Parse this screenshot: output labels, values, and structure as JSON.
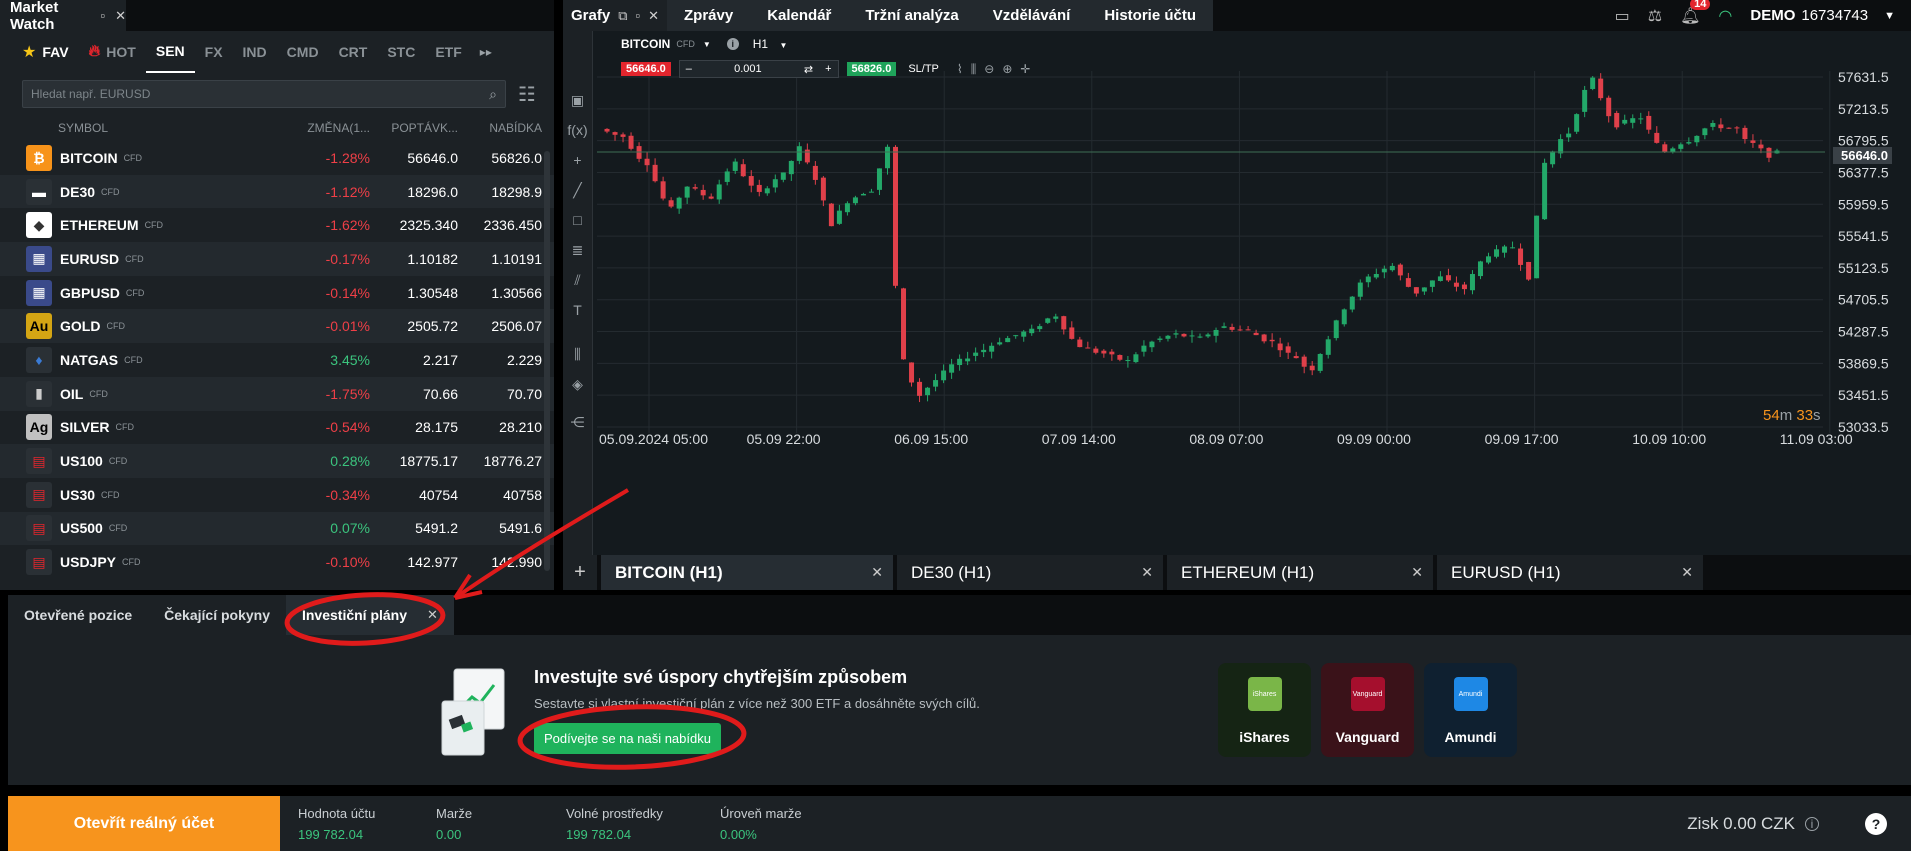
{
  "market_watch": {
    "title": "Market Watch",
    "tabs": [
      {
        "label": "FAV",
        "icon": "star-icon"
      },
      {
        "label": "HOT",
        "icon": "fire-icon"
      },
      {
        "label": "SEN"
      },
      {
        "label": "FX"
      },
      {
        "label": "IND"
      },
      {
        "label": "CMD"
      },
      {
        "label": "CRT"
      },
      {
        "label": "STC"
      },
      {
        "label": "ETF"
      }
    ],
    "search_placeholder": "Hledat např. EURUSD",
    "columns": {
      "symbol": "SYMBOL",
      "change": "ZMĚNA(1...",
      "bid": "POPTÁVK...",
      "ask": "NABÍDKA"
    },
    "rows": [
      {
        "symbol": "BITCOIN",
        "tag": "CFD",
        "change": "-1.28%",
        "bid": "56646.0",
        "ask": "56826.0",
        "dir": "neg",
        "icon": "bitcoin-icon",
        "ic_bg": "#f7931a",
        "ic_fg": "#fff",
        "glyph": "₿"
      },
      {
        "symbol": "DE30",
        "tag": "CFD",
        "change": "-1.12%",
        "bid": "18296.0",
        "ask": "18298.9",
        "dir": "neg",
        "icon": "germany-flag-icon",
        "ic_bg": "#2a3035",
        "ic_fg": "#fff",
        "glyph": "▬"
      },
      {
        "symbol": "ETHEREUM",
        "tag": "CFD",
        "change": "-1.62%",
        "bid": "2325.340",
        "ask": "2336.450",
        "dir": "neg",
        "icon": "ethereum-icon",
        "ic_bg": "#ffffff",
        "ic_fg": "#333",
        "glyph": "◆"
      },
      {
        "symbol": "EURUSD",
        "tag": "CFD",
        "change": "-0.17%",
        "bid": "1.10182",
        "ask": "1.10191",
        "dir": "neg",
        "icon": "eu-us-flag-icon",
        "ic_bg": "#3a4a8a",
        "ic_fg": "#fff",
        "glyph": "▦"
      },
      {
        "symbol": "GBPUSD",
        "tag": "CFD",
        "change": "-0.14%",
        "bid": "1.30548",
        "ask": "1.30566",
        "dir": "neg",
        "icon": "gb-us-flag-icon",
        "ic_bg": "#3a4a8a",
        "ic_fg": "#fff",
        "glyph": "▦"
      },
      {
        "symbol": "GOLD",
        "tag": "CFD",
        "change": "-0.01%",
        "bid": "2505.72",
        "ask": "2506.07",
        "dir": "neg",
        "icon": "gold-icon",
        "ic_bg": "#d4a514",
        "ic_fg": "#000",
        "glyph": "Au"
      },
      {
        "symbol": "NATGAS",
        "tag": "CFD",
        "change": "3.45%",
        "bid": "2.217",
        "ask": "2.229",
        "dir": "pos",
        "icon": "flame-icon",
        "ic_bg": "#2a3035",
        "ic_fg": "#3a7bd5",
        "glyph": "♦"
      },
      {
        "symbol": "OIL",
        "tag": "CFD",
        "change": "-1.75%",
        "bid": "70.66",
        "ask": "70.70",
        "dir": "neg",
        "icon": "oil-barrel-icon",
        "ic_bg": "#2a3035",
        "ic_fg": "#ccc",
        "glyph": "▮"
      },
      {
        "symbol": "SILVER",
        "tag": "CFD",
        "change": "-0.54%",
        "bid": "28.175",
        "ask": "28.210",
        "dir": "neg",
        "icon": "silver-icon",
        "ic_bg": "#c0c0c0",
        "ic_fg": "#000",
        "glyph": "Ag"
      },
      {
        "symbol": "US100",
        "tag": "CFD",
        "change": "0.28%",
        "bid": "18775.17",
        "ask": "18776.27",
        "dir": "pos",
        "icon": "us-flag-icon",
        "ic_bg": "#2a3035",
        "ic_fg": "#e3252d",
        "glyph": "▤"
      },
      {
        "symbol": "US30",
        "tag": "CFD",
        "change": "-0.34%",
        "bid": "40754",
        "ask": "40758",
        "dir": "neg",
        "icon": "us-flag-icon",
        "ic_bg": "#2a3035",
        "ic_fg": "#e3252d",
        "glyph": "▤"
      },
      {
        "symbol": "US500",
        "tag": "CFD",
        "change": "0.07%",
        "bid": "5491.2",
        "ask": "5491.6",
        "dir": "pos",
        "icon": "us-flag-icon",
        "ic_bg": "#2a3035",
        "ic_fg": "#e3252d",
        "glyph": "▤"
      },
      {
        "symbol": "USDJPY",
        "tag": "CFD",
        "change": "-0.10%",
        "bid": "142.977",
        "ask": "142.990",
        "dir": "neg",
        "icon": "us-jp-flag-icon",
        "ic_bg": "#2a3035",
        "ic_fg": "#e3252d",
        "glyph": "▤"
      }
    ]
  },
  "charts_window": {
    "title": "Grafy",
    "menu": [
      "Zprávy",
      "Kalendář",
      "Tržní analýza",
      "Vzdělávání",
      "Historie účtu"
    ],
    "notifications": "14",
    "account_mode": "DEMO",
    "account_number": "16734743"
  },
  "chart": {
    "symbol": "BITCOIN",
    "tag": "CFD",
    "timeframe": "H1",
    "sell_price": "56646.0",
    "volume": "0.001",
    "buy_price": "56826.0",
    "sltp": "SL/TP",
    "current_price": "56646.0",
    "countdown_min": "54",
    "countdown_sec": "33",
    "countdown_min_unit": "m",
    "countdown_sec_unit": "s",
    "y_ticks": [
      "57631.5",
      "57213.5",
      "56795.5",
      "56377.5",
      "55959.5",
      "55541.5",
      "55123.5",
      "54705.5",
      "54287.5",
      "53869.5",
      "53451.5",
      "53033.5"
    ],
    "x_ticks": [
      "05.09.2024 05:00",
      "05.09 22:00",
      "06.09 15:00",
      "07.09 14:00",
      "08.09 07:00",
      "09.09 00:00",
      "09.09 17:00",
      "10.09 10:00",
      "11.09 03:00"
    ],
    "colors": {
      "up": "#23a869",
      "down": "#e0404a",
      "grid": "#242b30"
    }
  },
  "chart_tabs": [
    "BITCOIN (H1)",
    "DE30 (H1)",
    "ETHEREUM (H1)",
    "EURUSD (H1)"
  ],
  "bottom_panel": {
    "tabs": [
      "Otevřené pozice",
      "Čekající pokyny",
      "Investiční plány"
    ],
    "promo_title": "Investujte své úspory chytřejším způsobem",
    "promo_text": "Sestavte si vlastní investiční plán z více než 300 ETF a dosáhněte svých cílů.",
    "promo_cta": "Podívejte se na naši nabídku",
    "brands": [
      {
        "name": "iShares",
        "logo": "iShares",
        "bg": "#152414",
        "logo_bg": "#7ab648"
      },
      {
        "name": "Vanguard",
        "logo": "Vanguard",
        "bg": "#3a1219",
        "logo_bg": "#a50f2d"
      },
      {
        "name": "Amundi",
        "logo": "Amundi",
        "bg": "#0f2030",
        "logo_bg": "#1e88e5"
      }
    ]
  },
  "footer": {
    "open_account": "Otevřít reálný účet",
    "stats": [
      {
        "label": "Hodnota účtu",
        "value": "199 782.04"
      },
      {
        "label": "Marže",
        "value": "0.00"
      },
      {
        "label": "Volné prostředky",
        "value": "199 782.04"
      },
      {
        "label": "Úroveň marže",
        "value": "0.00%"
      }
    ],
    "profit": "Zisk 0.00 CZK",
    "help": "?"
  }
}
